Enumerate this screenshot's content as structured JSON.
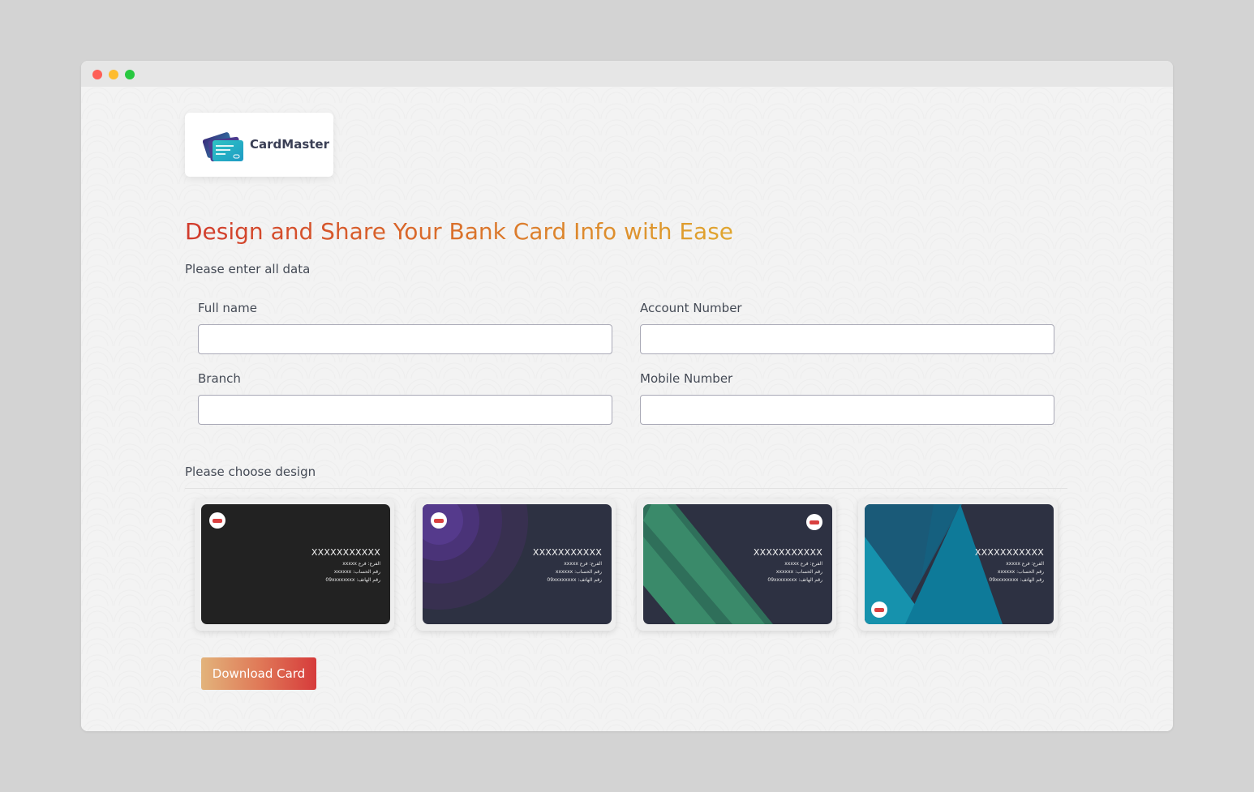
{
  "brand": {
    "name": "CardMaster",
    "logo_icon": "card-stack-icon"
  },
  "headline": "Design and Share Your Bank Card Info with Ease",
  "subtitle": "Please enter all data",
  "form": {
    "full_name": {
      "label": "Full name",
      "value": "",
      "placeholder": ""
    },
    "account_number": {
      "label": "Account Number",
      "value": "",
      "placeholder": ""
    },
    "branch": {
      "label": "Branch",
      "value": "",
      "placeholder": ""
    },
    "mobile_number": {
      "label": "Mobile Number",
      "value": "",
      "placeholder": ""
    }
  },
  "design_section": {
    "label": "Please choose design"
  },
  "designs": [
    {
      "name": "black",
      "number": "XXXXXXXXXXX",
      "branch_line": "الفرع: فرع xxxxx",
      "account_line": "رقم الحساب: xxxxxx",
      "phone_line": "رقم الهاتف: 09xxxxxxxx"
    },
    {
      "name": "purple-circles",
      "number": "XXXXXXXXXXX",
      "branch_line": "الفرع: فرع xxxxx",
      "account_line": "رقم الحساب: xxxxxx",
      "phone_line": "رقم الهاتف: 09xxxxxxxx"
    },
    {
      "name": "green-stripes",
      "number": "XXXXXXXXXXX",
      "branch_line": "الفرع: فرع xxxxx",
      "account_line": "رقم الحساب: xxxxxx",
      "phone_line": "رقم الهاتف: 09xxxxxxxx"
    },
    {
      "name": "teal-triangles",
      "number": "XXXXXXXXXXX",
      "branch_line": "الفرع: فرع xxxxx",
      "account_line": "رقم الحساب: xxxxxx",
      "phone_line": "رقم الهاتف: 09xxxxxxxx"
    }
  ],
  "actions": {
    "download_label": "Download Card"
  },
  "colors": {
    "heading_gradient": [
      "#d13a2c",
      "#e0a62f"
    ],
    "button_gradient": [
      "#e2b37b",
      "#d63b3b"
    ],
    "card_dark": "#2d3142"
  }
}
